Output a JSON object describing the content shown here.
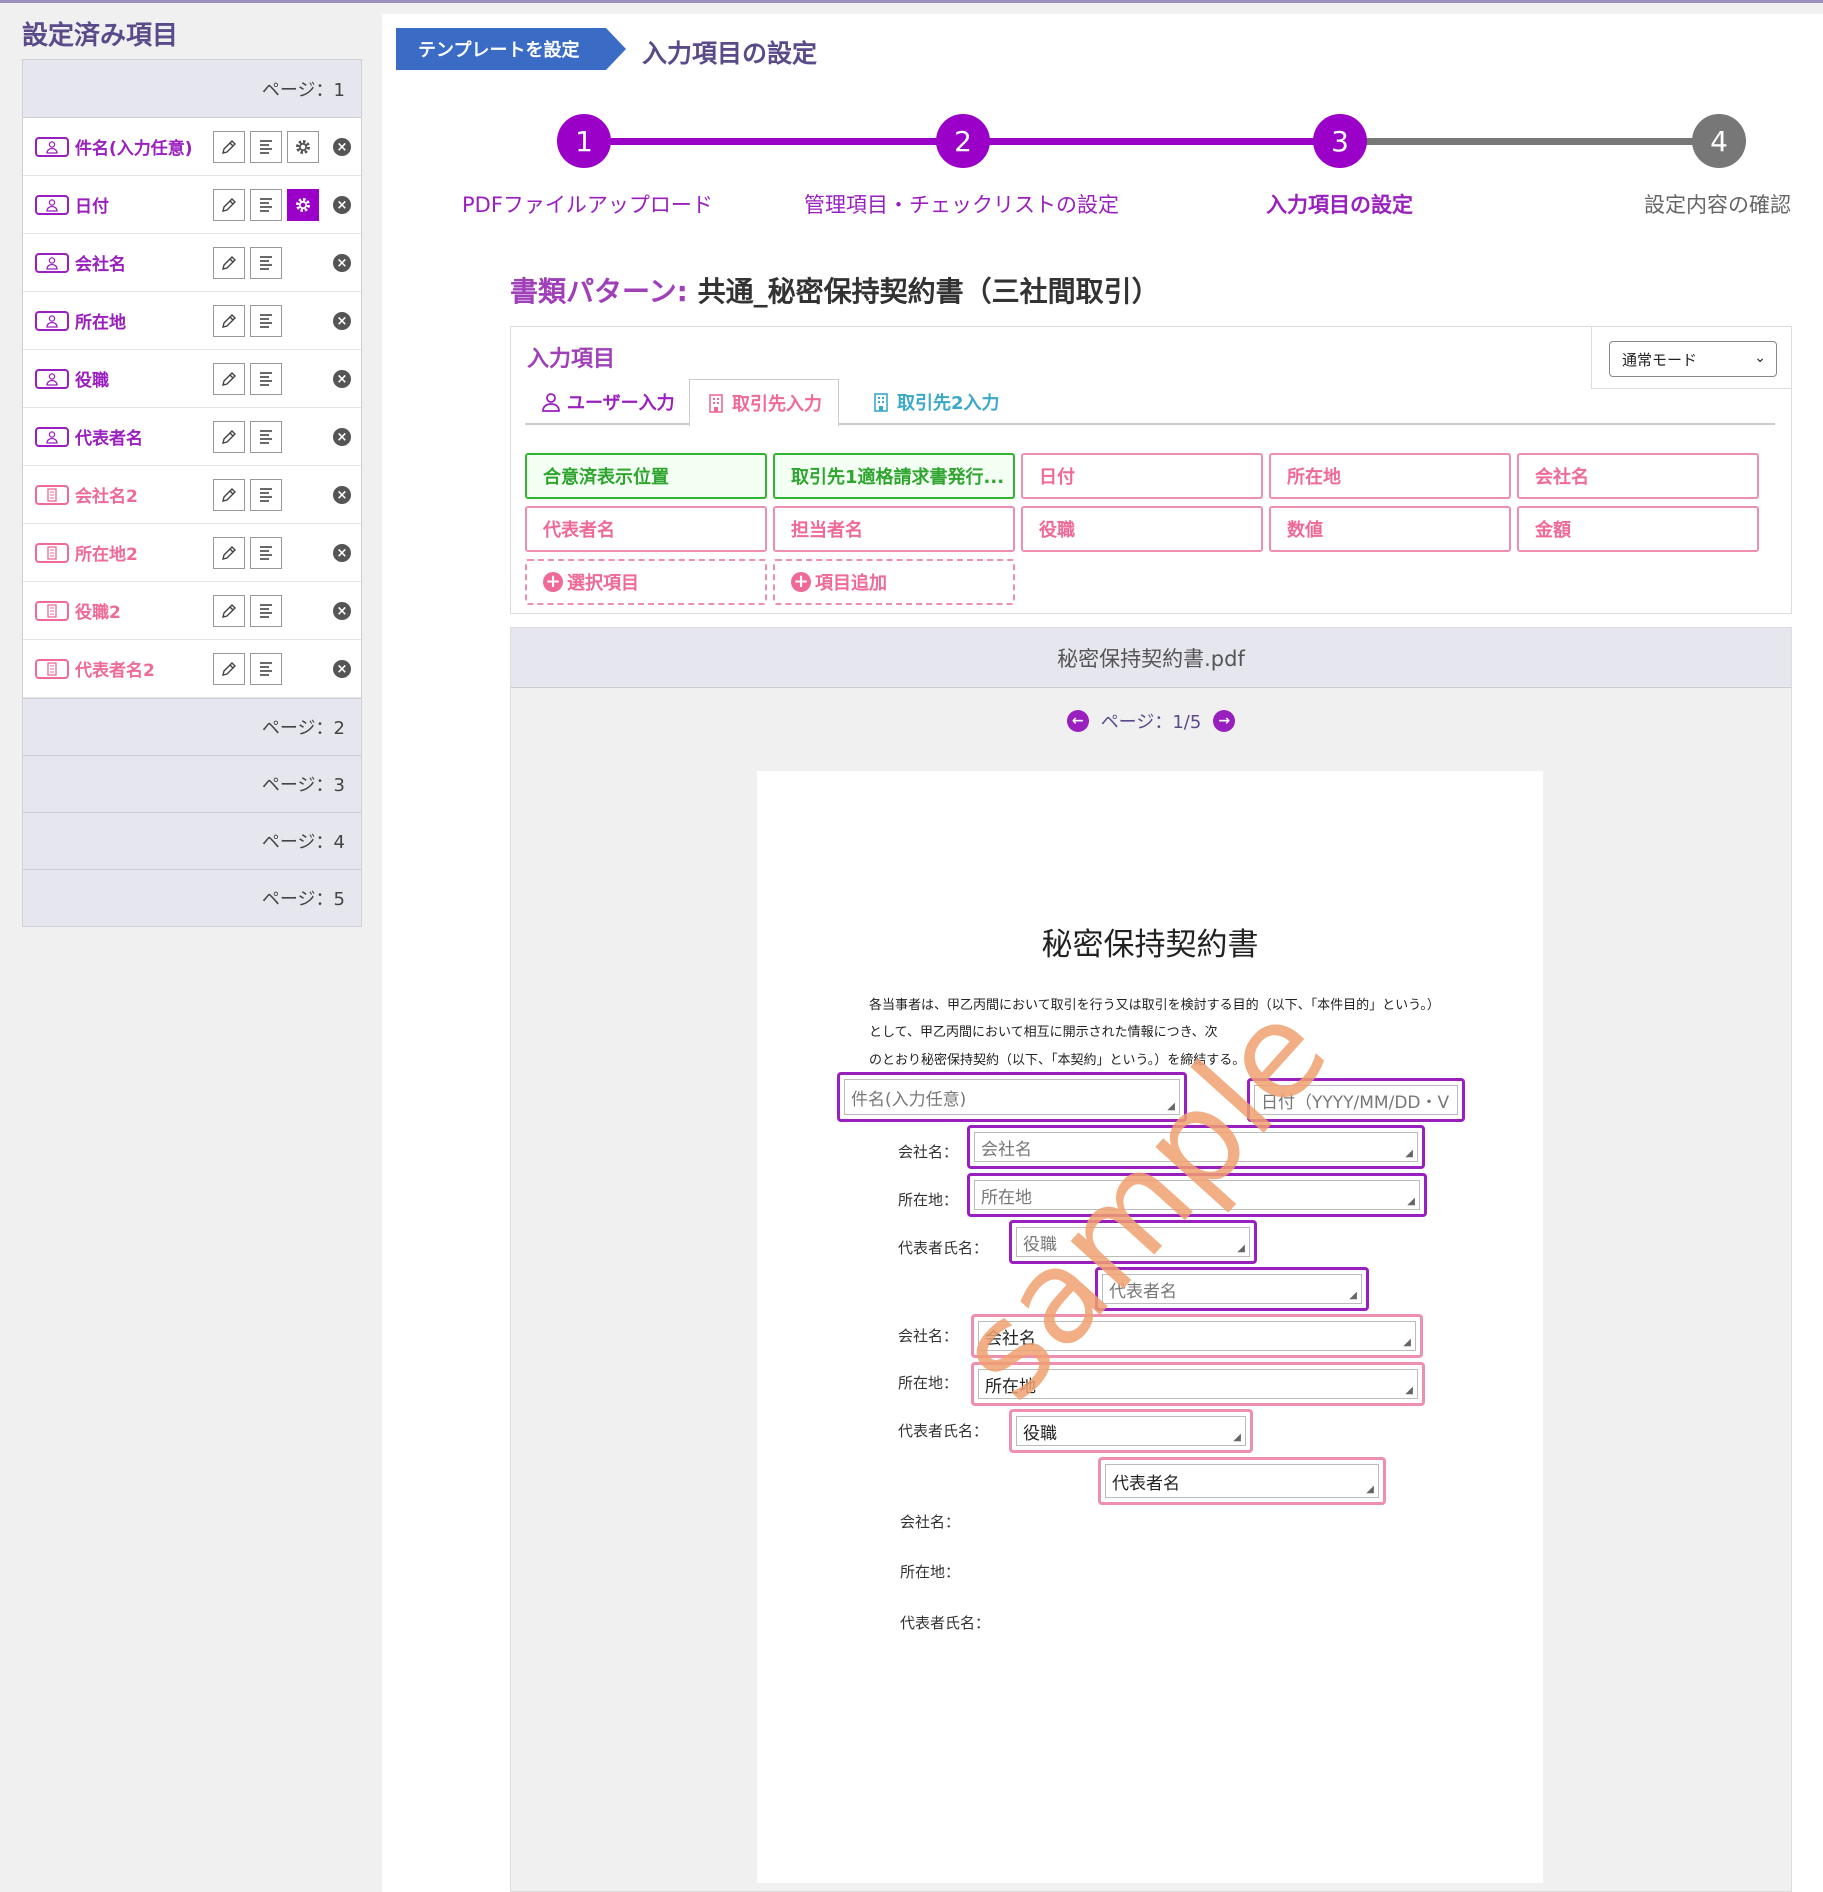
{
  "sidebar": {
    "title": "設定済み項目",
    "page1_label": "ページ：1",
    "items": [
      {
        "label": "件名(入力任意)",
        "type": "user"
      },
      {
        "label": "日付",
        "type": "user"
      },
      {
        "label": "会社名",
        "type": "user"
      },
      {
        "label": "所在地",
        "type": "user"
      },
      {
        "label": "役職",
        "type": "user"
      },
      {
        "label": "代表者名",
        "type": "user"
      },
      {
        "label": "会社名2",
        "type": "partner"
      },
      {
        "label": "所在地2",
        "type": "partner"
      },
      {
        "label": "役職2",
        "type": "partner"
      },
      {
        "label": "代表者名2",
        "type": "partner"
      }
    ],
    "pages": [
      "ページ：2",
      "ページ：3",
      "ページ：4",
      "ページ：5"
    ]
  },
  "header": {
    "breadcrumb": "テンプレートを設定",
    "title": "入力項目の設定"
  },
  "steps": [
    {
      "num": "1",
      "label": "PDFファイルアップロード"
    },
    {
      "num": "2",
      "label": "管理項目・チェックリストの設定"
    },
    {
      "num": "3",
      "label": "入力項目の設定"
    },
    {
      "num": "4",
      "label": "設定内容の確認"
    }
  ],
  "pattern": {
    "label": "書類パターン:",
    "value": "共通_秘密保持契約書（三社間取引）"
  },
  "input_panel": {
    "title": "入力項目",
    "mode": "通常モード",
    "tabs": [
      "ユーザー入力",
      "取引先入力",
      "取引先2入力"
    ],
    "fields": [
      "合意済表示位置",
      "取引先1適格請求書発行...",
      "日付",
      "所在地",
      "会社名",
      "代表者名",
      "担当者名",
      "役職",
      "数値",
      "金額"
    ],
    "add_select": "選択項目",
    "add_item": "項目追加"
  },
  "pdf": {
    "filename": "秘密保持契約書.pdf",
    "pager": "ページ：1/5",
    "doc_title": "秘密保持契約書",
    "doc_lines": [
      "各当事者は、甲乙丙間において取引を行う又は取引を検討する目的（以下、「本件目的」という。）",
      "として、甲乙丙間において相互に開示された情報につき、次",
      "のとおり秘密保持契約（以下、「本契約」という。）を締結する。"
    ],
    "labels": {
      "company": "会社名：",
      "address": "所在地：",
      "rep": "代表者氏名："
    },
    "fields": {
      "subject": "件名(入力任意)",
      "date": "日付（YYYY/MM/DD・V",
      "company1": "会社名",
      "address1": "所在地",
      "title1": "役職",
      "rep1": "代表者名",
      "company2": "会社名",
      "address2": "所在地",
      "title2": "役職",
      "rep2": "代表者名"
    },
    "watermark": "sample"
  },
  "colors": {
    "purple": "#9a1fbf",
    "pink": "#ef6a96",
    "green": "#2fb52f",
    "blue": "#3a6cc6",
    "gray_step": "#777777"
  }
}
